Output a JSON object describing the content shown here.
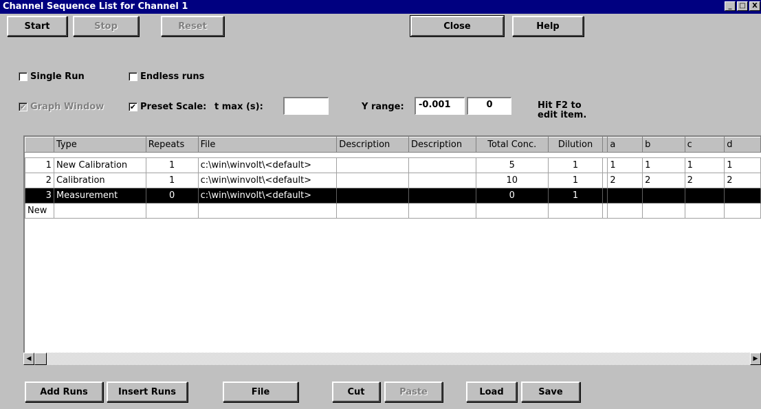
{
  "window": {
    "title": "Channel Sequence List for Channel 1",
    "controls": [
      "_",
      "□",
      "X"
    ]
  },
  "toolbar": {
    "start": "Start",
    "stop": "Stop",
    "reset": "Reset",
    "close": "Close",
    "help": "Help"
  },
  "options": {
    "single_run": {
      "label": "Single Run",
      "checked": false
    },
    "endless_runs": {
      "label": "Endless runs",
      "checked": false
    },
    "graph_window": {
      "label": "Graph Window",
      "checked": true
    },
    "preset_scale": {
      "label": "Preset Scale:",
      "checked": true
    },
    "check_mark": "✔",
    "tmax_label": "t max (s):",
    "tmax_value": "",
    "yrange_label": "Y range:",
    "yrange_min": "-0.001",
    "yrange_max": "0",
    "hint_line1": "Hit F2 to",
    "hint_line2": "edit item."
  },
  "table": {
    "columns": [
      "",
      "Type",
      "Repeats",
      "File",
      "Description",
      "Description",
      "Total Conc.",
      "Dilution",
      "",
      "a",
      "b",
      "c",
      "d"
    ],
    "rows": [
      [
        "1",
        "New Calibration",
        "1",
        "c:\\win\\winvolt\\<default>",
        "",
        "",
        "5",
        "1",
        "",
        "1",
        "1",
        "1",
        "1"
      ],
      [
        "2",
        "Calibration",
        "1",
        "c:\\win\\winvolt\\<default>",
        "",
        "",
        "10",
        "1",
        "",
        "2",
        "2",
        "2",
        "2"
      ],
      [
        "3",
        "Measurement",
        "0",
        "c:\\win\\winvolt\\<default>",
        "",
        "",
        "0",
        "1",
        "",
        "",
        "",
        "",
        ""
      ],
      [
        "New",
        "",
        "",
        "",
        "",
        "",
        "",
        "",
        "",
        "",
        "",
        "",
        ""
      ]
    ],
    "selected_row": 2
  },
  "scrollbar": {
    "left_arrow": "◀",
    "right_arrow": "▶"
  },
  "bottom": {
    "add_runs": "Add Runs",
    "insert_runs": "Insert Runs",
    "file": "File",
    "cut": "Cut",
    "paste": "Paste",
    "load": "Load",
    "save": "Save"
  }
}
